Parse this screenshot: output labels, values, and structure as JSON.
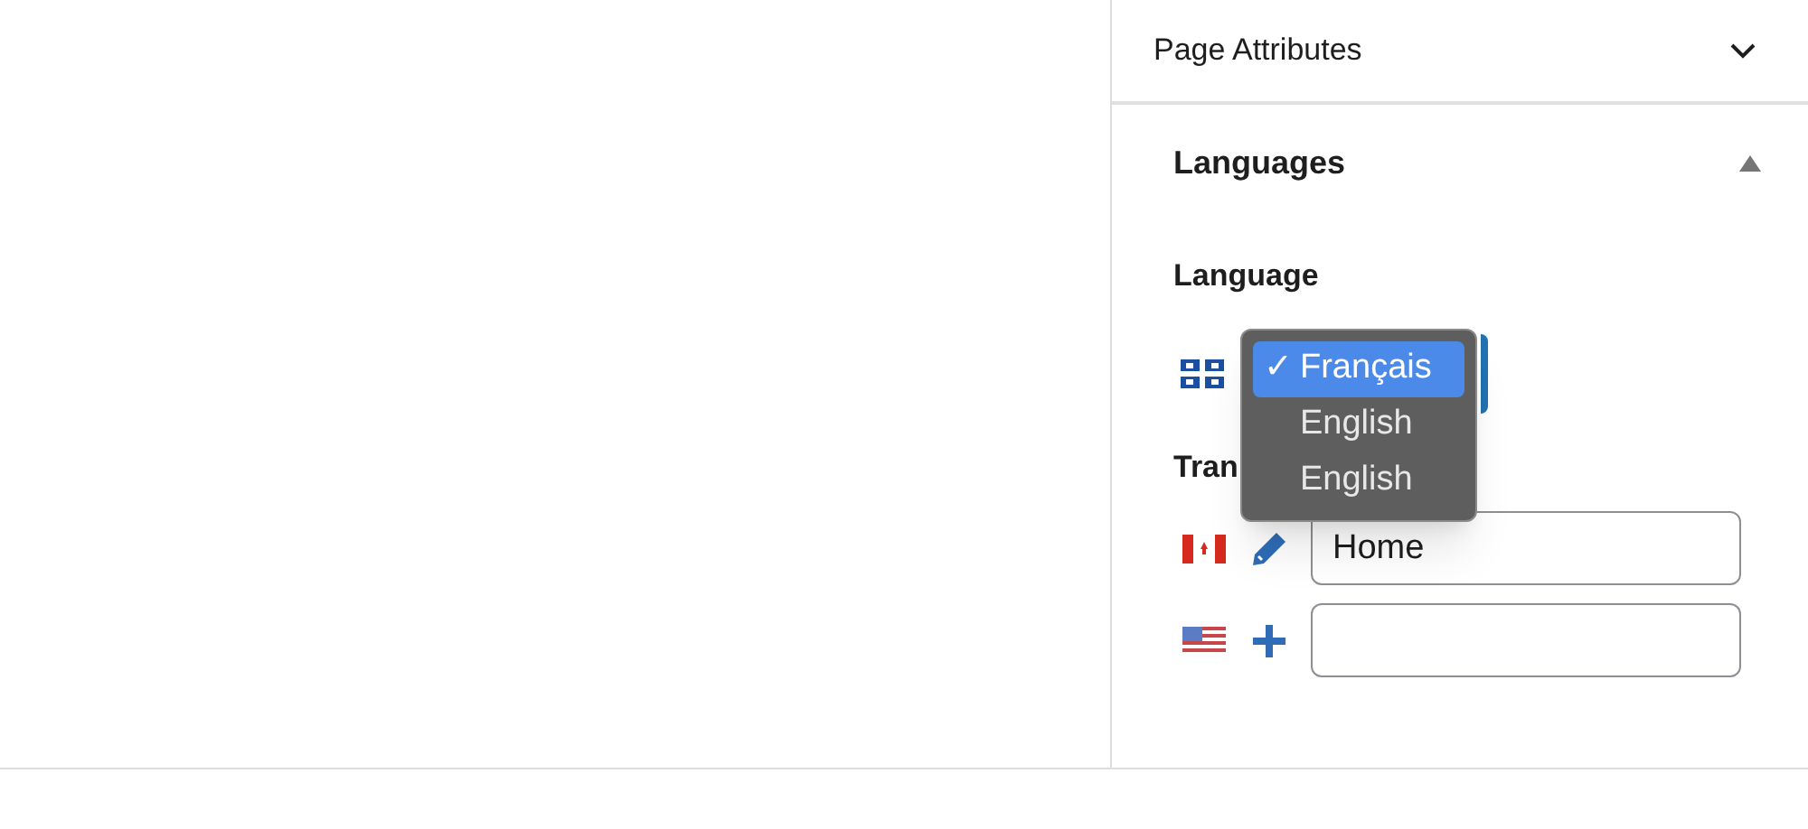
{
  "panels": [
    {
      "title": "Page Attributes",
      "expanded": false
    },
    {
      "title": "Languages",
      "expanded": true
    }
  ],
  "language": {
    "label": "Language",
    "check_mark": "✓",
    "options": [
      {
        "label": "Français",
        "selected": true
      },
      {
        "label": "English",
        "selected": false
      },
      {
        "label": "English",
        "selected": false
      }
    ]
  },
  "translations": {
    "label": "Tran",
    "rows": [
      {
        "kind": "edit",
        "value": "Home"
      },
      {
        "kind": "add"
      }
    ]
  }
}
